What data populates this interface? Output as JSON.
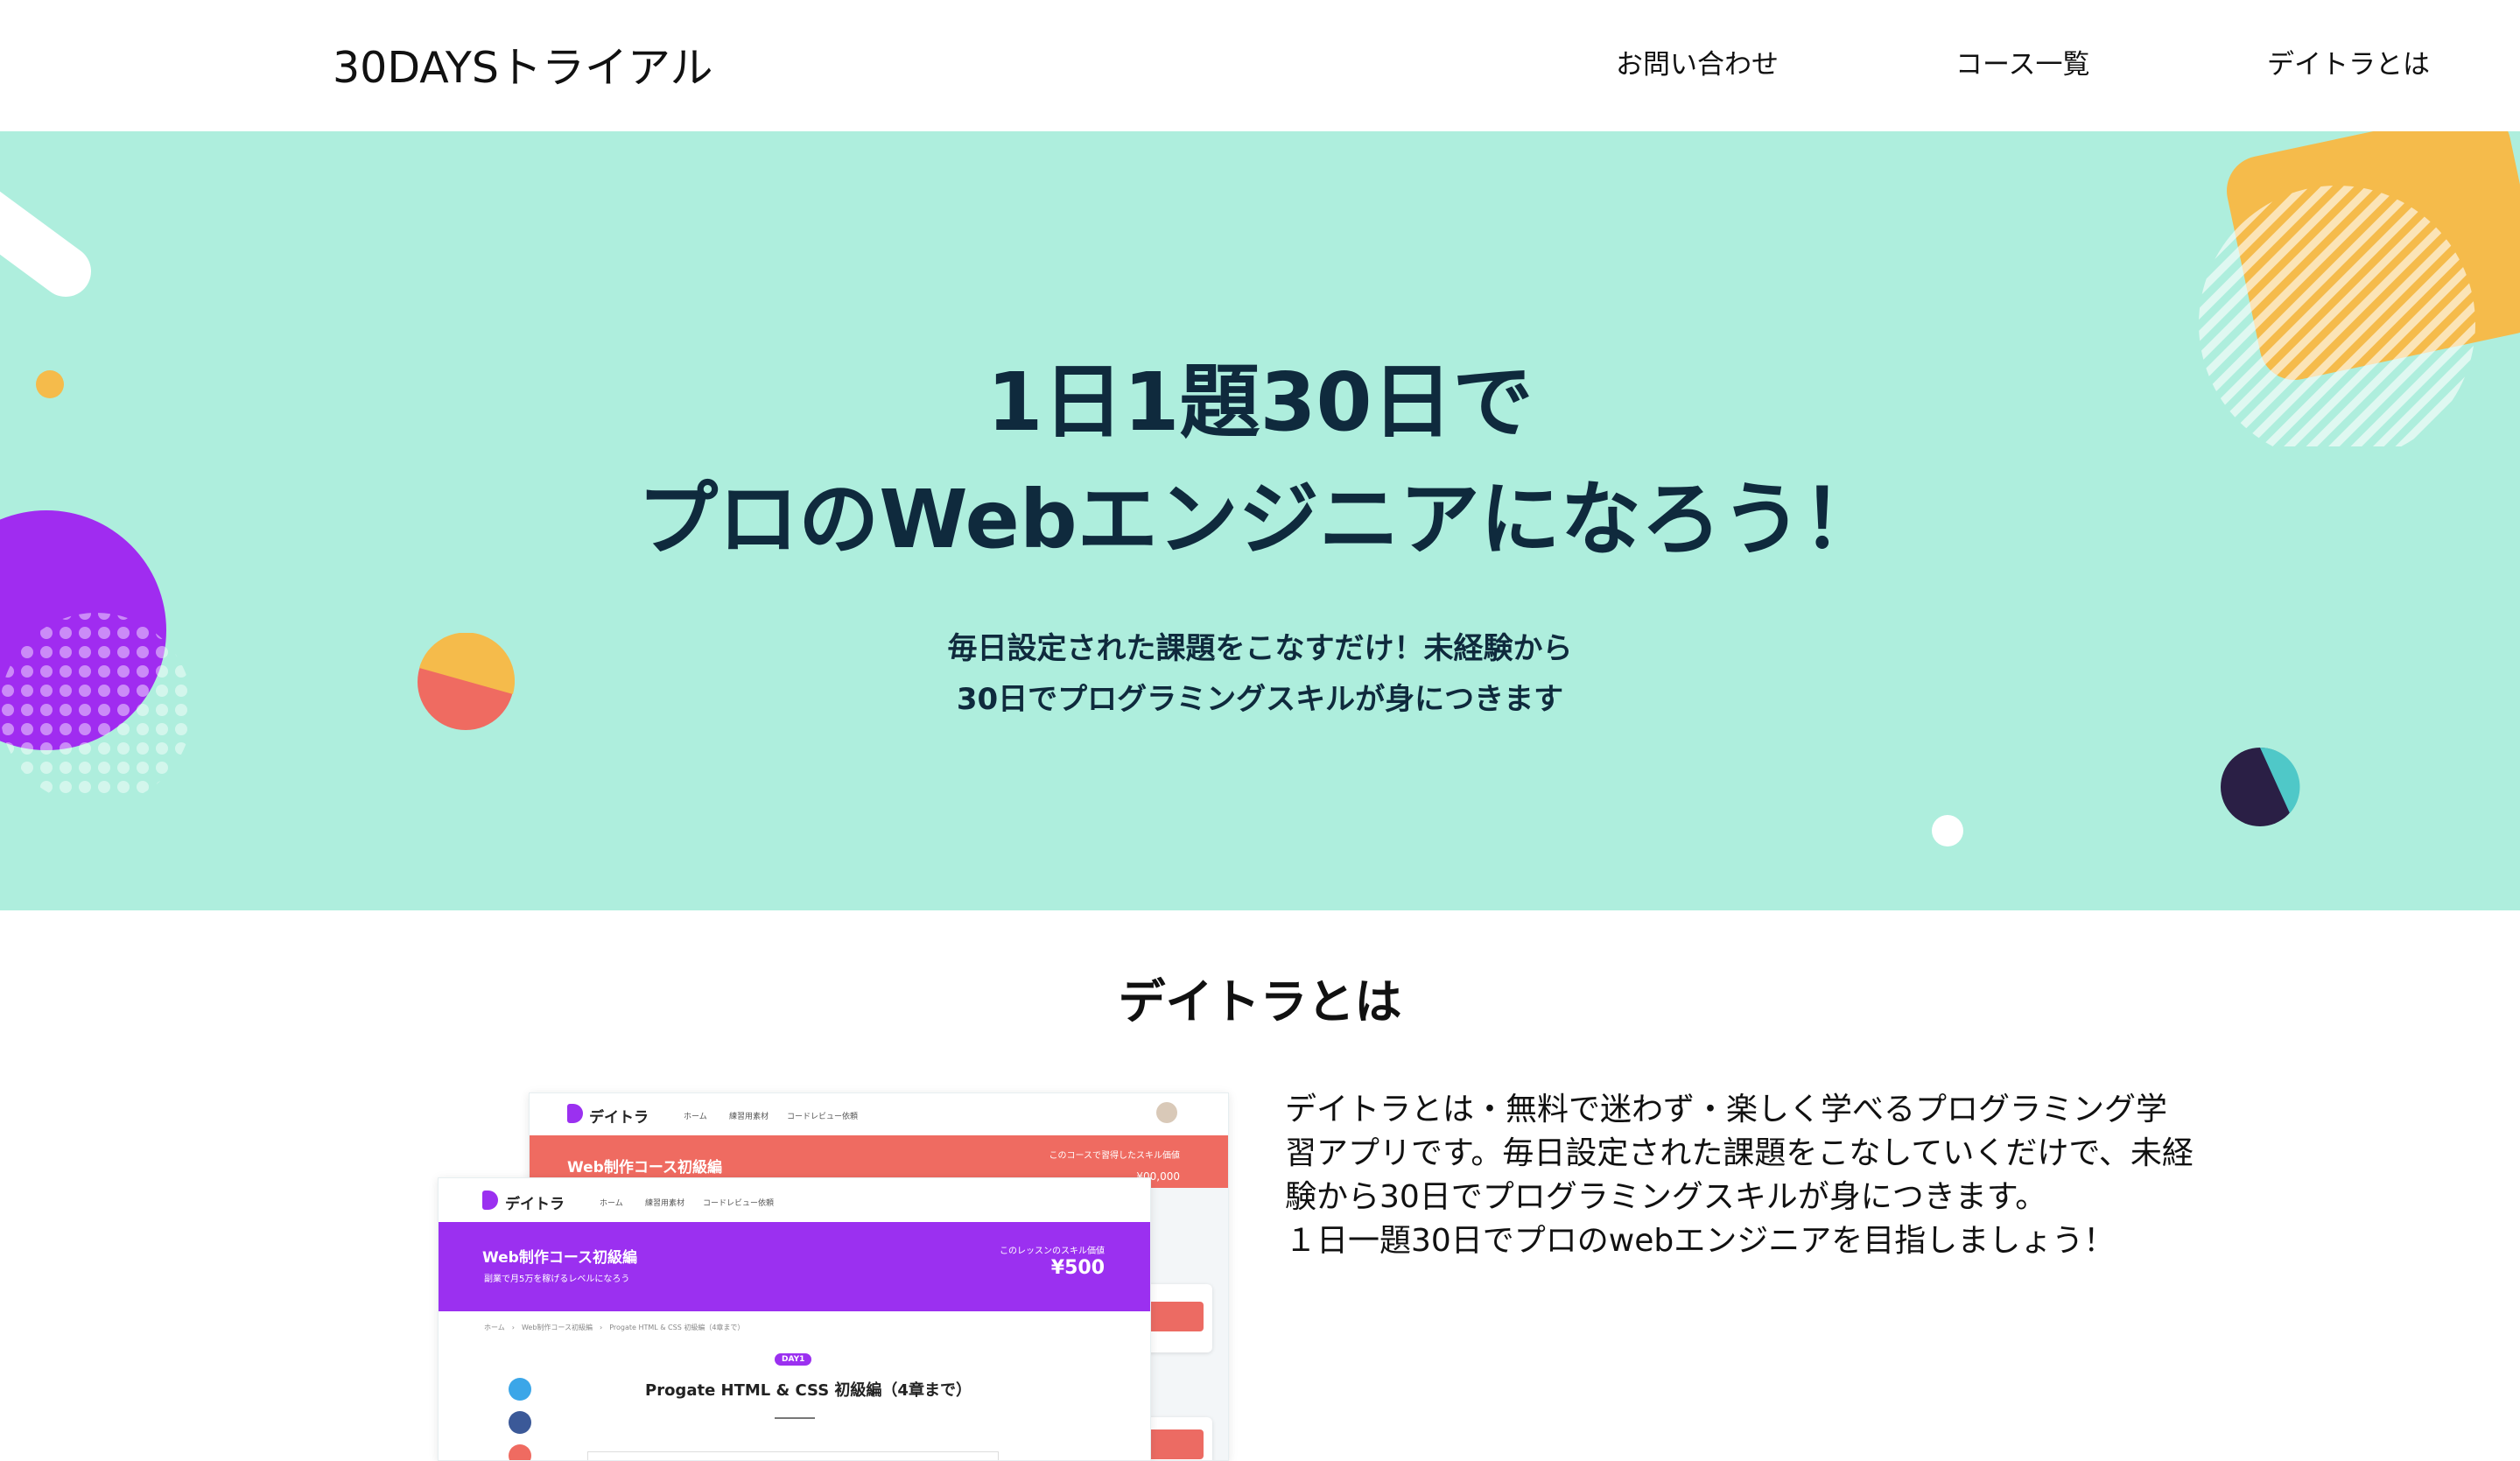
{
  "header": {
    "logo": "30DAYSトライアル",
    "nav": {
      "contact": "お問い合わせ",
      "courses": "コース一覧",
      "about": "デイトラとは"
    }
  },
  "hero": {
    "title_line1": "1日1題30日で",
    "title_line2": "プロのWebエンジニアになろう！",
    "sub_line1": "毎日設定された課題をこなすだけ！未経験から",
    "sub_line2": "30日でプログラミングスキルが身につきます",
    "colors": {
      "background": "#aeeedd",
      "purple": "#a02cf0",
      "orange": "#f5bb4b",
      "coral": "#ef6b61",
      "navy": "#2a1f45",
      "teal": "#4fc8c8"
    }
  },
  "about": {
    "title": "デイトラとは",
    "text_lines": [
      "デイトラとは・無料で迷わず・楽しく学べるプログラミング学",
      "習アプリです。毎日設定された課題をこなしていくだけで、未経",
      "験から30日でプログラミングスキルが身につきます。",
      "１日一題30日でプロのwebエンジニアを目指しましょう！"
    ]
  },
  "mockup_back": {
    "logo": "デイトラ",
    "nav": [
      "ホーム",
      "練習用素材",
      "コードレビュー依頼"
    ],
    "banner_title": "Web制作コース初級編",
    "price_label": "このコースで習得したスキル価値",
    "price_partial": "¥00,000",
    "banner_color": "#ef6b61"
  },
  "mockup_front": {
    "logo": "デイトラ",
    "nav": [
      "ホーム",
      "練習用素材",
      "コードレビュー依頼"
    ],
    "banner_title": "Web制作コース初級編",
    "banner_sub": "副業で月5万を稼げるレベルになろう",
    "price_label": "このレッスンのスキル価値",
    "price": "¥500",
    "breadcrumb": "ホーム　›　Web制作コース初級編　›　Progate HTML & CSS 初級編（4章まで）",
    "day_badge": "DAY1",
    "lesson_title": "Progate HTML & CSS 初級編（4章まで）",
    "banner_color": "#9b30f0"
  }
}
